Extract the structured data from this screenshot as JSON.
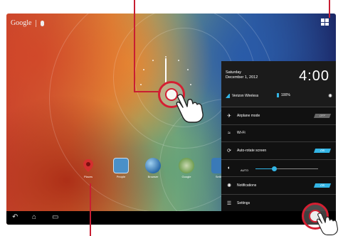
{
  "home": {
    "search_label": "Google",
    "apps": [
      {
        "label": "Places",
        "icon": "map-pin-icon",
        "color": "#d32f2f"
      },
      {
        "label": "People",
        "icon": "contacts-icon",
        "color": "#4a90c8"
      },
      {
        "label": "Browser",
        "icon": "globe-icon",
        "color": "#3d7cc2"
      },
      {
        "label": "Google",
        "icon": "google-folder-icon",
        "color": "#6a9a4a"
      },
      {
        "label": "Settin",
        "icon": "settings-app-icon",
        "color": "#3a7ab8"
      }
    ]
  },
  "quick_settings": {
    "day": "Saturday",
    "date": "December 1, 2012",
    "time": "4:00",
    "carrier": "Verizon Wireless",
    "battery": "100%",
    "rows": [
      {
        "label": "Airplane mode",
        "icon": "airplane-icon",
        "toggle": "OFF"
      },
      {
        "label": "Wi-Fi",
        "icon": "wifi-icon",
        "toggle": ""
      },
      {
        "label": "Auto-rotate screen",
        "icon": "rotate-icon",
        "toggle": "ON"
      },
      {
        "label": "AUTO",
        "icon": "brightness-icon",
        "toggle": ""
      },
      {
        "label": "Notifications",
        "icon": "notifications-icon",
        "toggle": "ON"
      },
      {
        "label": "Settings",
        "icon": "settings-sliders-icon",
        "toggle": ""
      }
    ],
    "brightness_level": 0.3
  },
  "colors": {
    "accent": "#33b5e5",
    "callout": "#c81e32"
  }
}
